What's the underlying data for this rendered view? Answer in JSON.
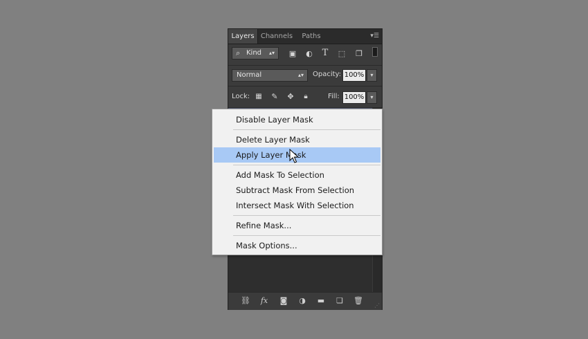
{
  "panel": {
    "tabs": [
      "Layers",
      "Channels",
      "Paths"
    ],
    "tab_menu_icon": "panel-menu-icon",
    "filter": {
      "kind_label": "Kind",
      "icons": [
        "image-filter-icon",
        "adjustment-filter-icon",
        "type-filter-icon",
        "shape-filter-icon",
        "smart-object-filter-icon"
      ]
    },
    "blend": {
      "mode": "Normal",
      "opacity_label": "Opacity:",
      "opacity_value": "100%"
    },
    "lock": {
      "label": "Lock:",
      "icons": [
        "lock-transparent-icon",
        "lock-image-icon",
        "lock-position-icon",
        "lock-all-icon"
      ],
      "fill_label": "Fill:",
      "fill_value": "100%"
    },
    "footer_icons": [
      "link-layers-icon",
      "fx-icon",
      "add-mask-icon",
      "adjustment-layer-icon",
      "group-icon",
      "new-layer-icon",
      "delete-icon"
    ]
  },
  "context_menu": {
    "items": [
      "Disable Layer Mask",
      "Delete Layer Mask",
      "Apply Layer Mask",
      "Add Mask To Selection",
      "Subtract Mask From Selection",
      "Intersect Mask With Selection",
      "Refine Mask...",
      "Mask Options..."
    ],
    "highlighted": "Apply Layer Mask"
  },
  "colors": {
    "canvas_bg": "#808080",
    "panel_bg": "#323232",
    "selected_layer": "#585e73",
    "menu_bg": "#f1f1f1",
    "menu_highlight": "#a8c9f5"
  }
}
